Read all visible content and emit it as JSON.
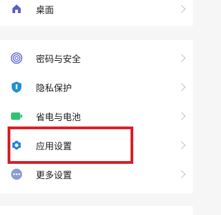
{
  "settings": {
    "items": [
      {
        "label": "桌面",
        "icon": "home-icon"
      },
      {
        "label": "密码与安全",
        "icon": "fingerprint-icon"
      },
      {
        "label": "隐私保护",
        "icon": "shield-icon"
      },
      {
        "label": "省电与电池",
        "icon": "battery-icon"
      },
      {
        "label": "应用设置",
        "icon": "gear-icon"
      },
      {
        "label": "更多设置",
        "icon": "more-icon"
      }
    ]
  },
  "colors": {
    "highlight": "#d81f26",
    "home": "#5b5fc7",
    "fingerprint": "#6b6fd6",
    "shield": "#1e8fd6",
    "battery": "#2fc275",
    "gear": "#1f7fe0",
    "more": "#8a9bd6"
  }
}
